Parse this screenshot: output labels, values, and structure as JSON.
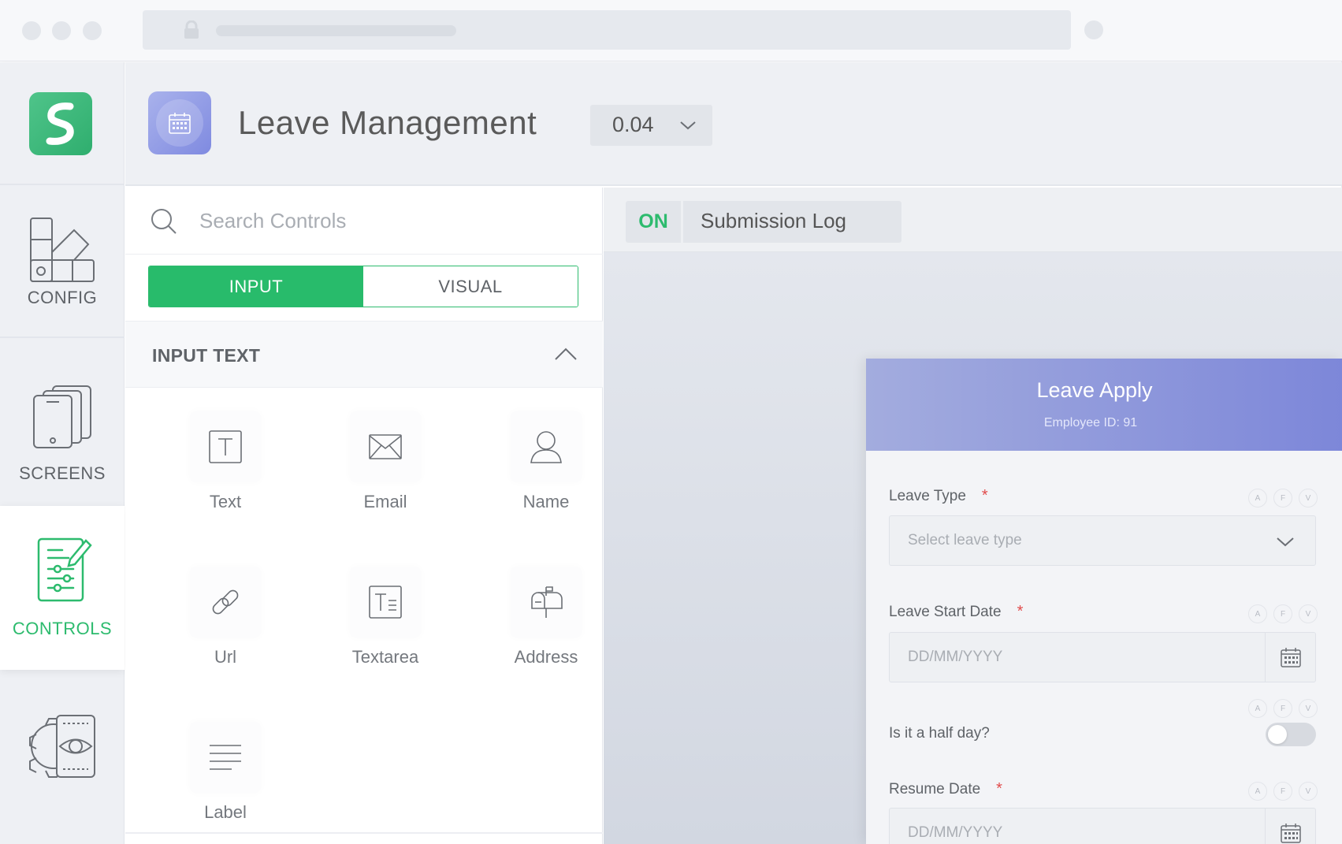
{
  "app": {
    "title": "Leave Management",
    "version": "0.04"
  },
  "colors": {
    "accent_green": "#2dbb6e",
    "form_header_start": "#a3acde",
    "form_header_end": "#7d87d9",
    "required_star": "#e14b4b"
  },
  "rail": {
    "items": [
      {
        "label": "CONFIG",
        "icon": "config-icon",
        "active": false
      },
      {
        "label": "SCREENS",
        "icon": "screens-icon",
        "active": false
      },
      {
        "label": "CONTROLS",
        "icon": "controls-icon",
        "active": true
      },
      {
        "label": "",
        "icon": "preview-gear-icon",
        "active": false
      }
    ]
  },
  "controls": {
    "search_placeholder": "Search Controls",
    "tabs": [
      {
        "label": "INPUT",
        "selected": true
      },
      {
        "label": "VISUAL",
        "selected": false
      }
    ],
    "section_title": "INPUT TEXT",
    "items": [
      {
        "label": "Text",
        "icon": "text-box-icon"
      },
      {
        "label": "Email",
        "icon": "envelope-icon"
      },
      {
        "label": "Name",
        "icon": "person-icon"
      },
      {
        "label": "Url",
        "icon": "link-icon"
      },
      {
        "label": "Textarea",
        "icon": "textarea-icon"
      },
      {
        "label": "Address",
        "icon": "mailbox-icon"
      },
      {
        "label": "Label",
        "icon": "lines-icon"
      }
    ]
  },
  "canvas": {
    "status": "ON",
    "log_label": "Submission Log"
  },
  "form": {
    "title": "Leave Apply",
    "subtitle": "Employee ID: 91",
    "badge_letters": [
      "A",
      "F",
      "V"
    ],
    "fields": [
      {
        "label": "Leave Type",
        "required": "*",
        "placeholder": "Select leave type",
        "kind": "select"
      },
      {
        "label": "Leave Start Date",
        "required": "*",
        "placeholder": "DD/MM/YYYY",
        "kind": "date"
      },
      {
        "label": "Is it a half day?",
        "kind": "toggle",
        "value": "off"
      },
      {
        "label": "Resume Date",
        "required": "*",
        "placeholder": "DD/MM/YYYY",
        "kind": "date"
      }
    ]
  }
}
